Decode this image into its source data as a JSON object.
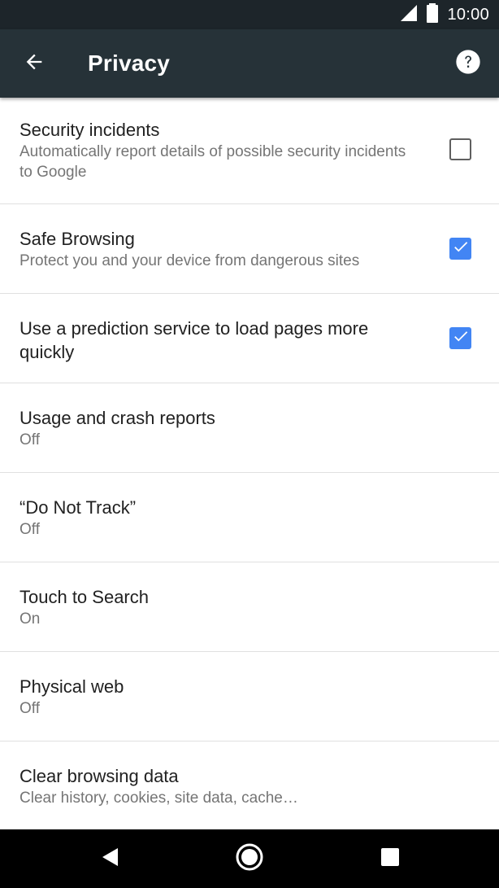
{
  "status_bar": {
    "time": "10:00",
    "icons": [
      "cell-signal-icon",
      "battery-icon"
    ]
  },
  "app_bar": {
    "title": "Privacy",
    "back_icon": "arrow-back-icon",
    "help_icon": "help-icon"
  },
  "settings": [
    {
      "title": "Security incidents",
      "summary": "Automatically report details of possible security incidents to Google",
      "checkbox": true,
      "checked": false
    },
    {
      "title": "Safe Browsing",
      "summary": "Protect you and your device from dangerous sites",
      "checkbox": true,
      "checked": true
    },
    {
      "title": "Use a prediction service to load pages more quickly",
      "summary": "",
      "checkbox": true,
      "checked": true
    },
    {
      "title": "Usage and crash reports",
      "summary": "Off",
      "checkbox": false
    },
    {
      "title": "“Do Not Track”",
      "summary": "Off",
      "checkbox": false
    },
    {
      "title": "Touch to Search",
      "summary": "On",
      "checkbox": false
    },
    {
      "title": "Physical web",
      "summary": "Off",
      "checkbox": false
    },
    {
      "title": "Clear browsing data",
      "summary": "Clear history, cookies, site data, cache…",
      "checkbox": false
    }
  ],
  "nav_bar": {
    "icons": [
      "back-triangle-icon",
      "home-circle-icon",
      "recents-square-icon"
    ]
  },
  "colors": {
    "status_bar": "#1d252a",
    "app_bar": "#263238",
    "checkbox_checked": "#4285f4",
    "title_text": "#212121",
    "summary_text": "#757575",
    "divider": "#e0e0e0"
  }
}
